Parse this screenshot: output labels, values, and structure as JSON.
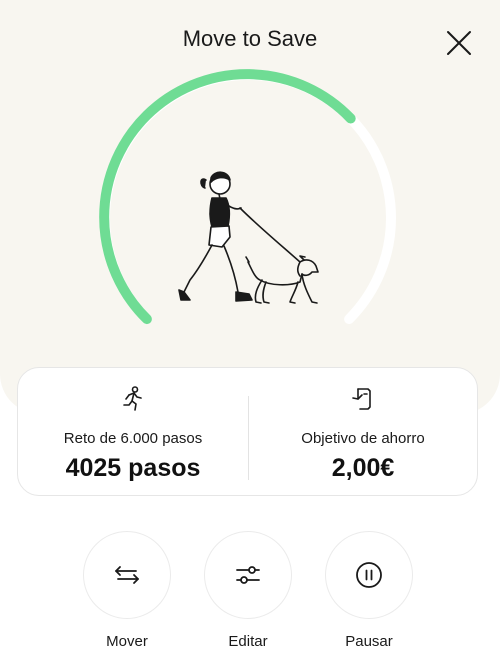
{
  "header": {
    "title": "Move to Save",
    "close_icon": "close-icon"
  },
  "progress": {
    "fraction": 0.67,
    "fill_color": "#6fdc94",
    "track_color": "#ffffff",
    "illustration": "woman-walking-dog"
  },
  "stats": {
    "steps": {
      "icon": "running-person-icon",
      "label": "Reto de 6.000 pasos",
      "value": "4025 pasos"
    },
    "savings": {
      "icon": "savings-goal-icon",
      "label": "Objetivo de ahorro",
      "value": "2,00€"
    }
  },
  "actions": [
    {
      "icon": "swap-arrows-icon",
      "label": "Mover"
    },
    {
      "icon": "sliders-icon",
      "label": "Editar"
    },
    {
      "icon": "pause-icon",
      "label": "Pausar"
    }
  ]
}
